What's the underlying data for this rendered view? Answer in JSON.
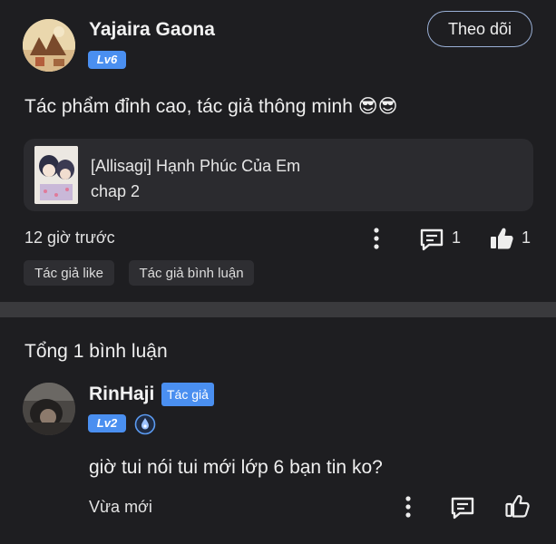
{
  "post": {
    "author": "Yajaira Gaona",
    "level": "Lv6",
    "follow_label": "Theo dõi",
    "content": "Tác phẩm đỉnh cao, tác giả thông minh 😎😎",
    "card": {
      "title": "[Allisagi] Hạnh Phúc Của Em",
      "chapter": "chap 2"
    },
    "time": "12 giờ trước",
    "comment_count": "1",
    "like_count": "1",
    "tags": [
      "Tác giả like",
      "Tác giả bình luận"
    ]
  },
  "comments_header": "Tổng 1 bình luận",
  "reply": {
    "author": "RinHaji",
    "author_tag": "Tác giả",
    "level": "Lv2",
    "content": "giờ tui nói tui mới lớp 6 bạn tin ko?",
    "time": "Vừa mới"
  },
  "colors": {
    "accent": "#4a8ff0",
    "background": "#1e1e21",
    "card": "#2b2b2f"
  },
  "icons": [
    "more-vertical-icon",
    "comment-icon",
    "thumbs-up-icon",
    "water-drop-badge-icon"
  ]
}
